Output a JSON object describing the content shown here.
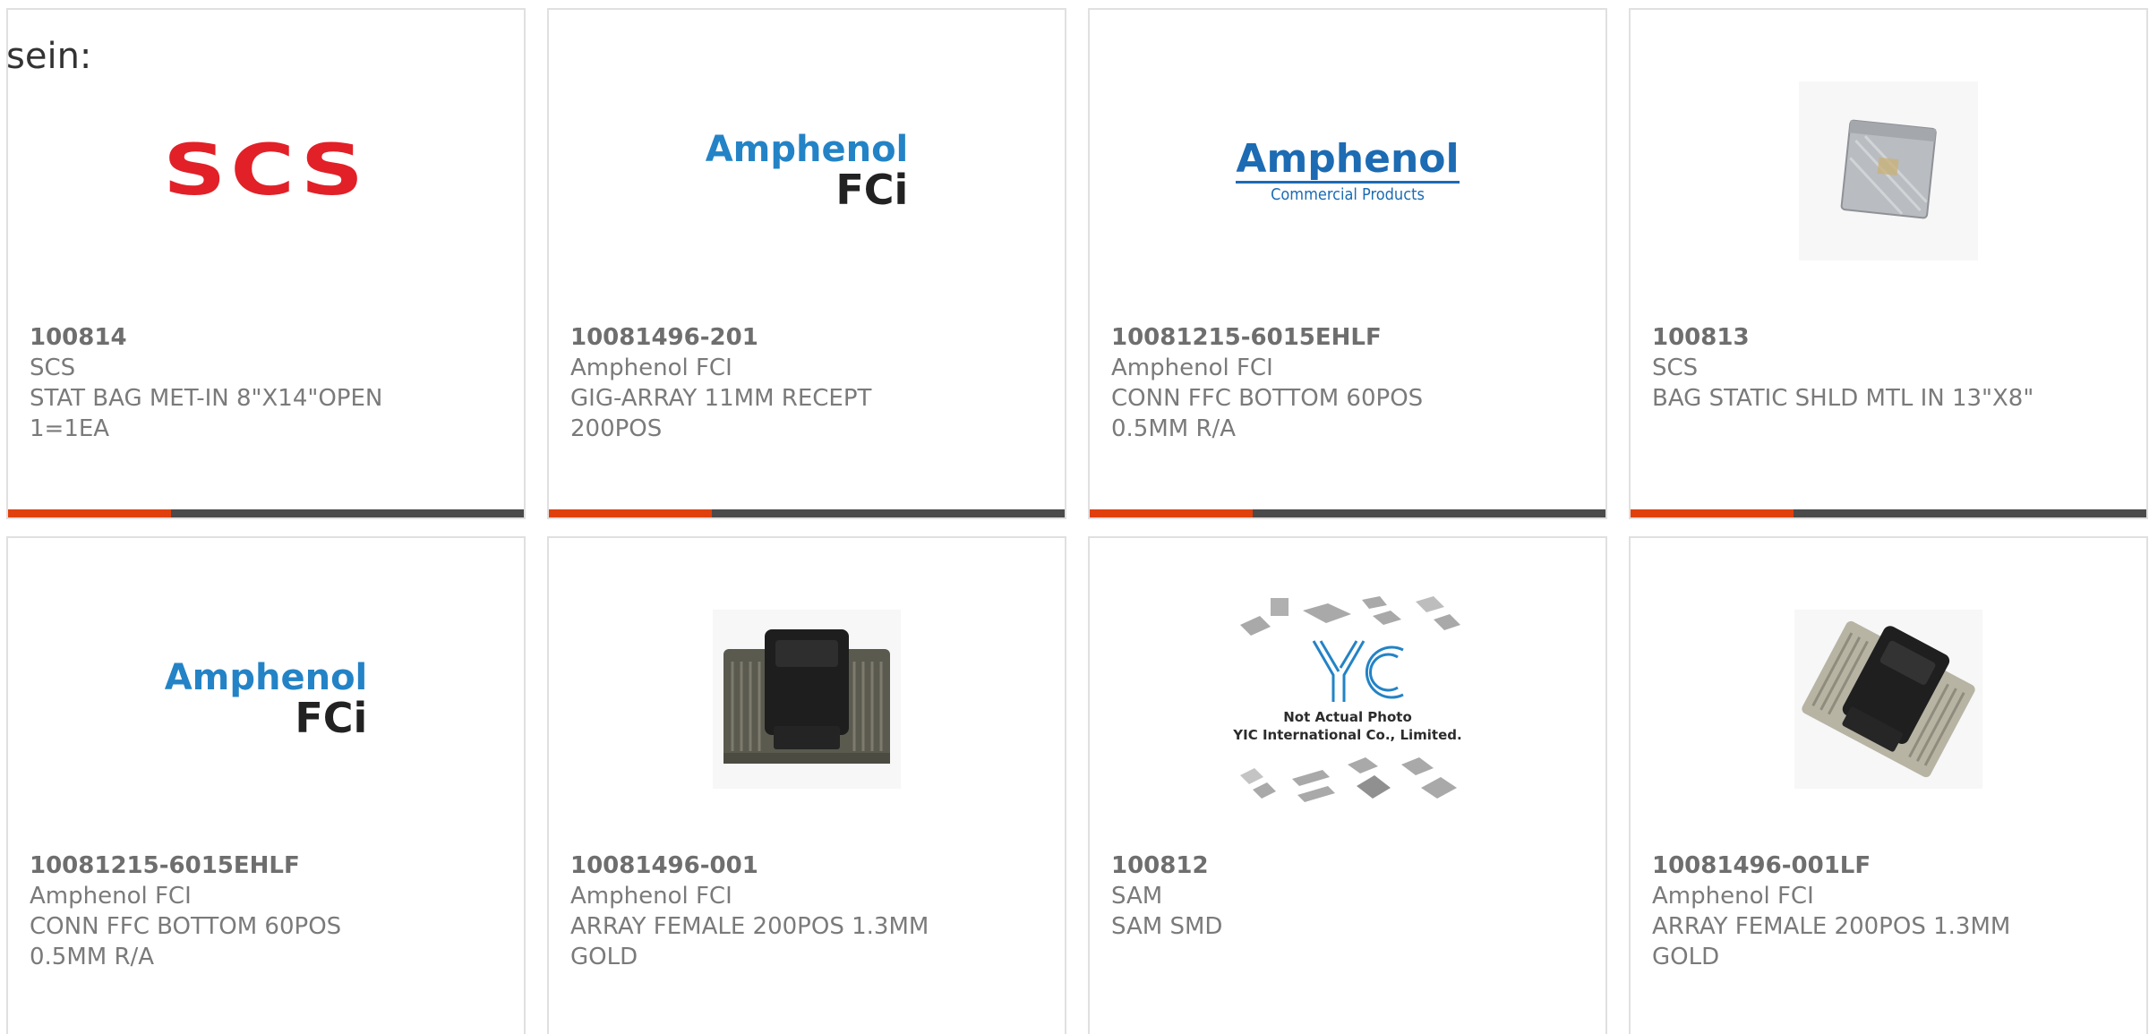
{
  "intro_text": "sein:",
  "colors": {
    "accent_bar": "#e0400e",
    "bar_base": "#4a4a4a",
    "scs_red": "#e22028",
    "amphenol_blue": "#2383c6"
  },
  "cards": [
    {
      "part_number": "100814",
      "manufacturer": "SCS",
      "desc_line1": "STAT BAG MET-IN 8\"X14\"OPEN",
      "desc_line2": "1=1EA",
      "image": "scs-logo",
      "logo_text": "SCS"
    },
    {
      "part_number": "10081496-201",
      "manufacturer": "Amphenol FCI",
      "desc_line1": "GIG-ARRAY 11MM RECEPT",
      "desc_line2": "200POS",
      "image": "amphenol-fci-logo",
      "logo_text": "Amphenol",
      "logo_sub": "FCi"
    },
    {
      "part_number": "10081215-6015EHLF",
      "manufacturer": "Amphenol FCI",
      "desc_line1": "CONN FFC BOTTOM 60POS",
      "desc_line2": "0.5MM R/A",
      "image": "amphenol-commercial-logo",
      "logo_text": "Amphenol",
      "logo_sub": "Commercial Products"
    },
    {
      "part_number": "100813",
      "manufacturer": "SCS",
      "desc_line1": "BAG STATIC SHLD MTL IN 13\"X8\"",
      "desc_line2": "",
      "image": "static-bag-photo"
    },
    {
      "part_number": "10081215-6015EHLF",
      "manufacturer": "Amphenol FCI",
      "desc_line1": "CONN FFC BOTTOM 60POS",
      "desc_line2": "0.5MM R/A",
      "image": "amphenol-fci-logo",
      "logo_text": "Amphenol",
      "logo_sub": "FCi"
    },
    {
      "part_number": "10081496-001",
      "manufacturer": "Amphenol FCI",
      "desc_line1": "ARRAY FEMALE 200POS 1.3MM",
      "desc_line2": "GOLD",
      "image": "connector-photo"
    },
    {
      "part_number": "100812",
      "manufacturer": "SAM",
      "desc_line1": "SAM SMD",
      "desc_line2": "",
      "image": "yic-placeholder",
      "placeholder_line1": "Not Actual Photo",
      "placeholder_line2": "YIC International Co., Limited."
    },
    {
      "part_number": "10081496-001LF",
      "manufacturer": "Amphenol FCI",
      "desc_line1": "ARRAY FEMALE 200POS 1.3MM",
      "desc_line2": "GOLD",
      "image": "connector-photo-angled"
    }
  ]
}
